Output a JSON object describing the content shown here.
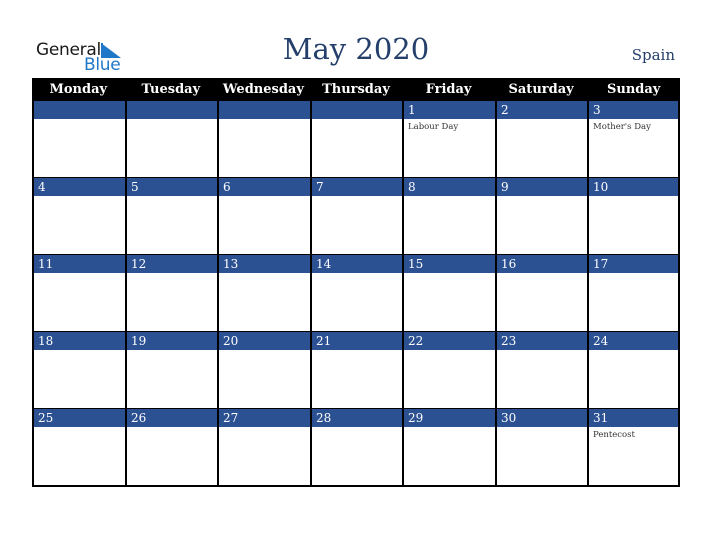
{
  "logo": {
    "general": "General",
    "blue": "Blue",
    "icon": "triangle-logo-icon"
  },
  "title": "May 2020",
  "country": "Spain",
  "colors": {
    "header_bg": "#000000",
    "day_bar": "#2c5192",
    "title": "#253f6b",
    "logo_blue": "#1f78c8"
  },
  "weekdays": [
    "Monday",
    "Tuesday",
    "Wednesday",
    "Thursday",
    "Friday",
    "Saturday",
    "Sunday"
  ],
  "weeks": [
    [
      {
        "day": "",
        "holiday": ""
      },
      {
        "day": "",
        "holiday": ""
      },
      {
        "day": "",
        "holiday": ""
      },
      {
        "day": "",
        "holiday": ""
      },
      {
        "day": "1",
        "holiday": "Labour Day"
      },
      {
        "day": "2",
        "holiday": ""
      },
      {
        "day": "3",
        "holiday": "Mother's Day"
      }
    ],
    [
      {
        "day": "4",
        "holiday": ""
      },
      {
        "day": "5",
        "holiday": ""
      },
      {
        "day": "6",
        "holiday": ""
      },
      {
        "day": "7",
        "holiday": ""
      },
      {
        "day": "8",
        "holiday": ""
      },
      {
        "day": "9",
        "holiday": ""
      },
      {
        "day": "10",
        "holiday": ""
      }
    ],
    [
      {
        "day": "11",
        "holiday": ""
      },
      {
        "day": "12",
        "holiday": ""
      },
      {
        "day": "13",
        "holiday": ""
      },
      {
        "day": "14",
        "holiday": ""
      },
      {
        "day": "15",
        "holiday": ""
      },
      {
        "day": "16",
        "holiday": ""
      },
      {
        "day": "17",
        "holiday": ""
      }
    ],
    [
      {
        "day": "18",
        "holiday": ""
      },
      {
        "day": "19",
        "holiday": ""
      },
      {
        "day": "20",
        "holiday": ""
      },
      {
        "day": "21",
        "holiday": ""
      },
      {
        "day": "22",
        "holiday": ""
      },
      {
        "day": "23",
        "holiday": ""
      },
      {
        "day": "24",
        "holiday": ""
      }
    ],
    [
      {
        "day": "25",
        "holiday": ""
      },
      {
        "day": "26",
        "holiday": ""
      },
      {
        "day": "27",
        "holiday": ""
      },
      {
        "day": "28",
        "holiday": ""
      },
      {
        "day": "29",
        "holiday": ""
      },
      {
        "day": "30",
        "holiday": ""
      },
      {
        "day": "31",
        "holiday": "Pentecost"
      }
    ]
  ]
}
